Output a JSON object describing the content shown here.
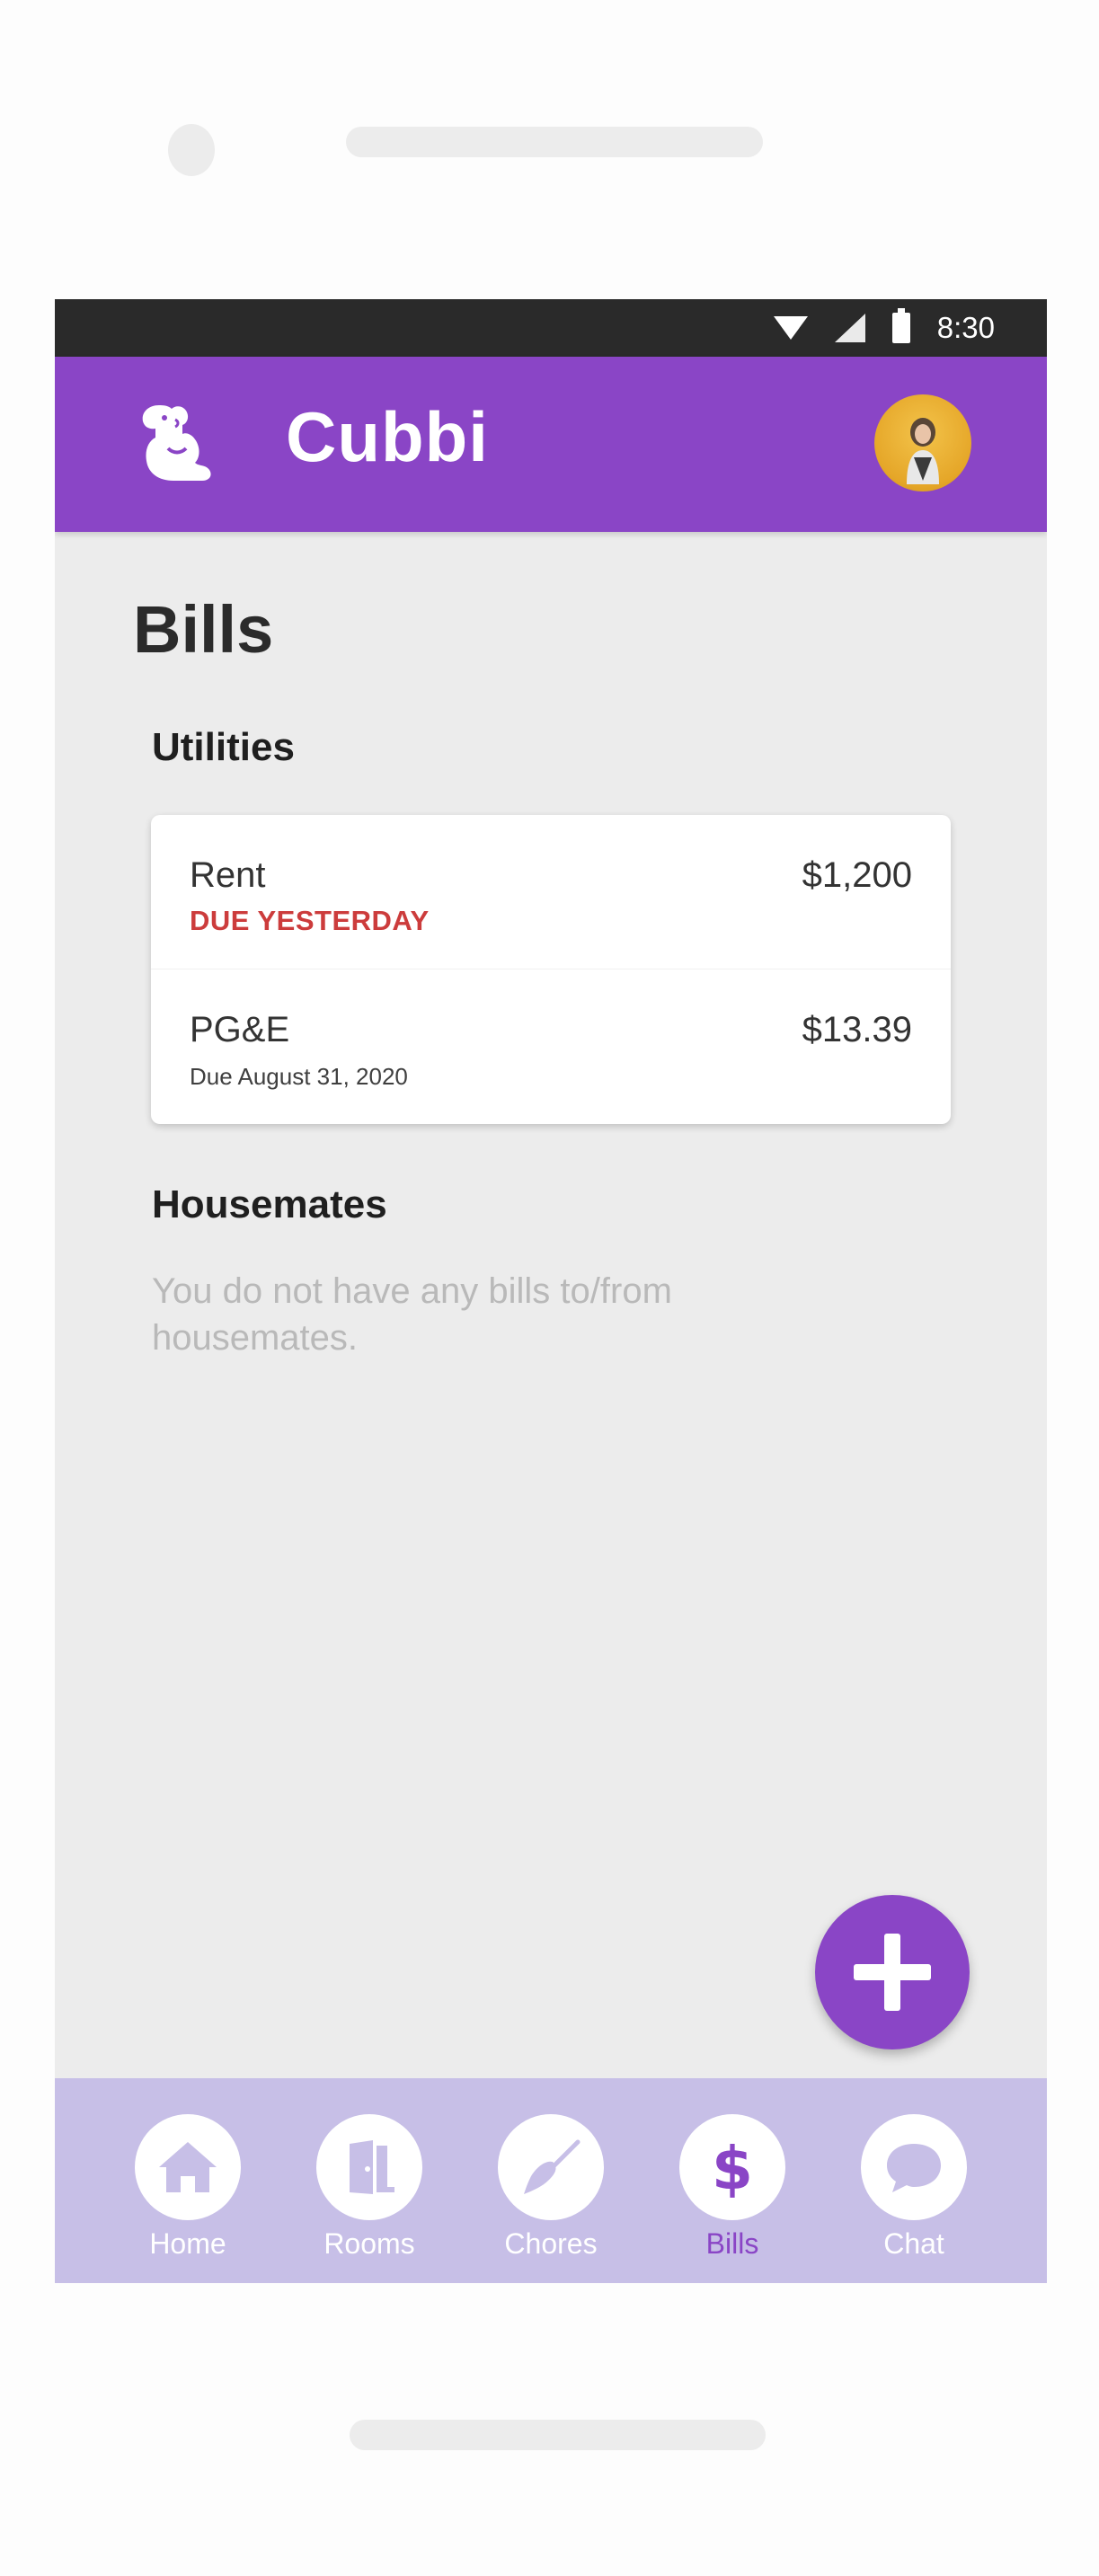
{
  "colors": {
    "primary": "#8a45c6",
    "nav_background": "#c7bfe7",
    "overdue": "#cc3c3c",
    "status_bar": "#2a2a2a",
    "screen_background": "#ececec"
  },
  "status_bar": {
    "time": "8:30",
    "icons": [
      "wifi-icon",
      "signal-icon",
      "battery-icon"
    ]
  },
  "app_bar": {
    "logo_icon": "cubbi-logo-icon",
    "title": "Cubbi",
    "avatar_icon": "user-avatar"
  },
  "page": {
    "title": "Bills"
  },
  "utilities": {
    "title": "Utilities",
    "bills": [
      {
        "name": "Rent",
        "due": "DUE YESTERDAY",
        "amount": "$1,200",
        "overdue": true
      },
      {
        "name": "PG&E",
        "due": "Due August 31, 2020",
        "amount": "$13.39",
        "overdue": false
      }
    ]
  },
  "housemates": {
    "title": "Housemates",
    "empty_message": "You do not have any bills to/from housemates."
  },
  "fab": {
    "icon": "plus-icon"
  },
  "bottom_nav": {
    "items": [
      {
        "label": "Home",
        "icon": "home-icon",
        "active": false
      },
      {
        "label": "Rooms",
        "icon": "door-icon",
        "active": false
      },
      {
        "label": "Chores",
        "icon": "broom-icon",
        "active": false
      },
      {
        "label": "Bills",
        "icon": "dollar-icon",
        "active": true
      },
      {
        "label": "Chat",
        "icon": "chat-bubble-icon",
        "active": false
      }
    ]
  }
}
